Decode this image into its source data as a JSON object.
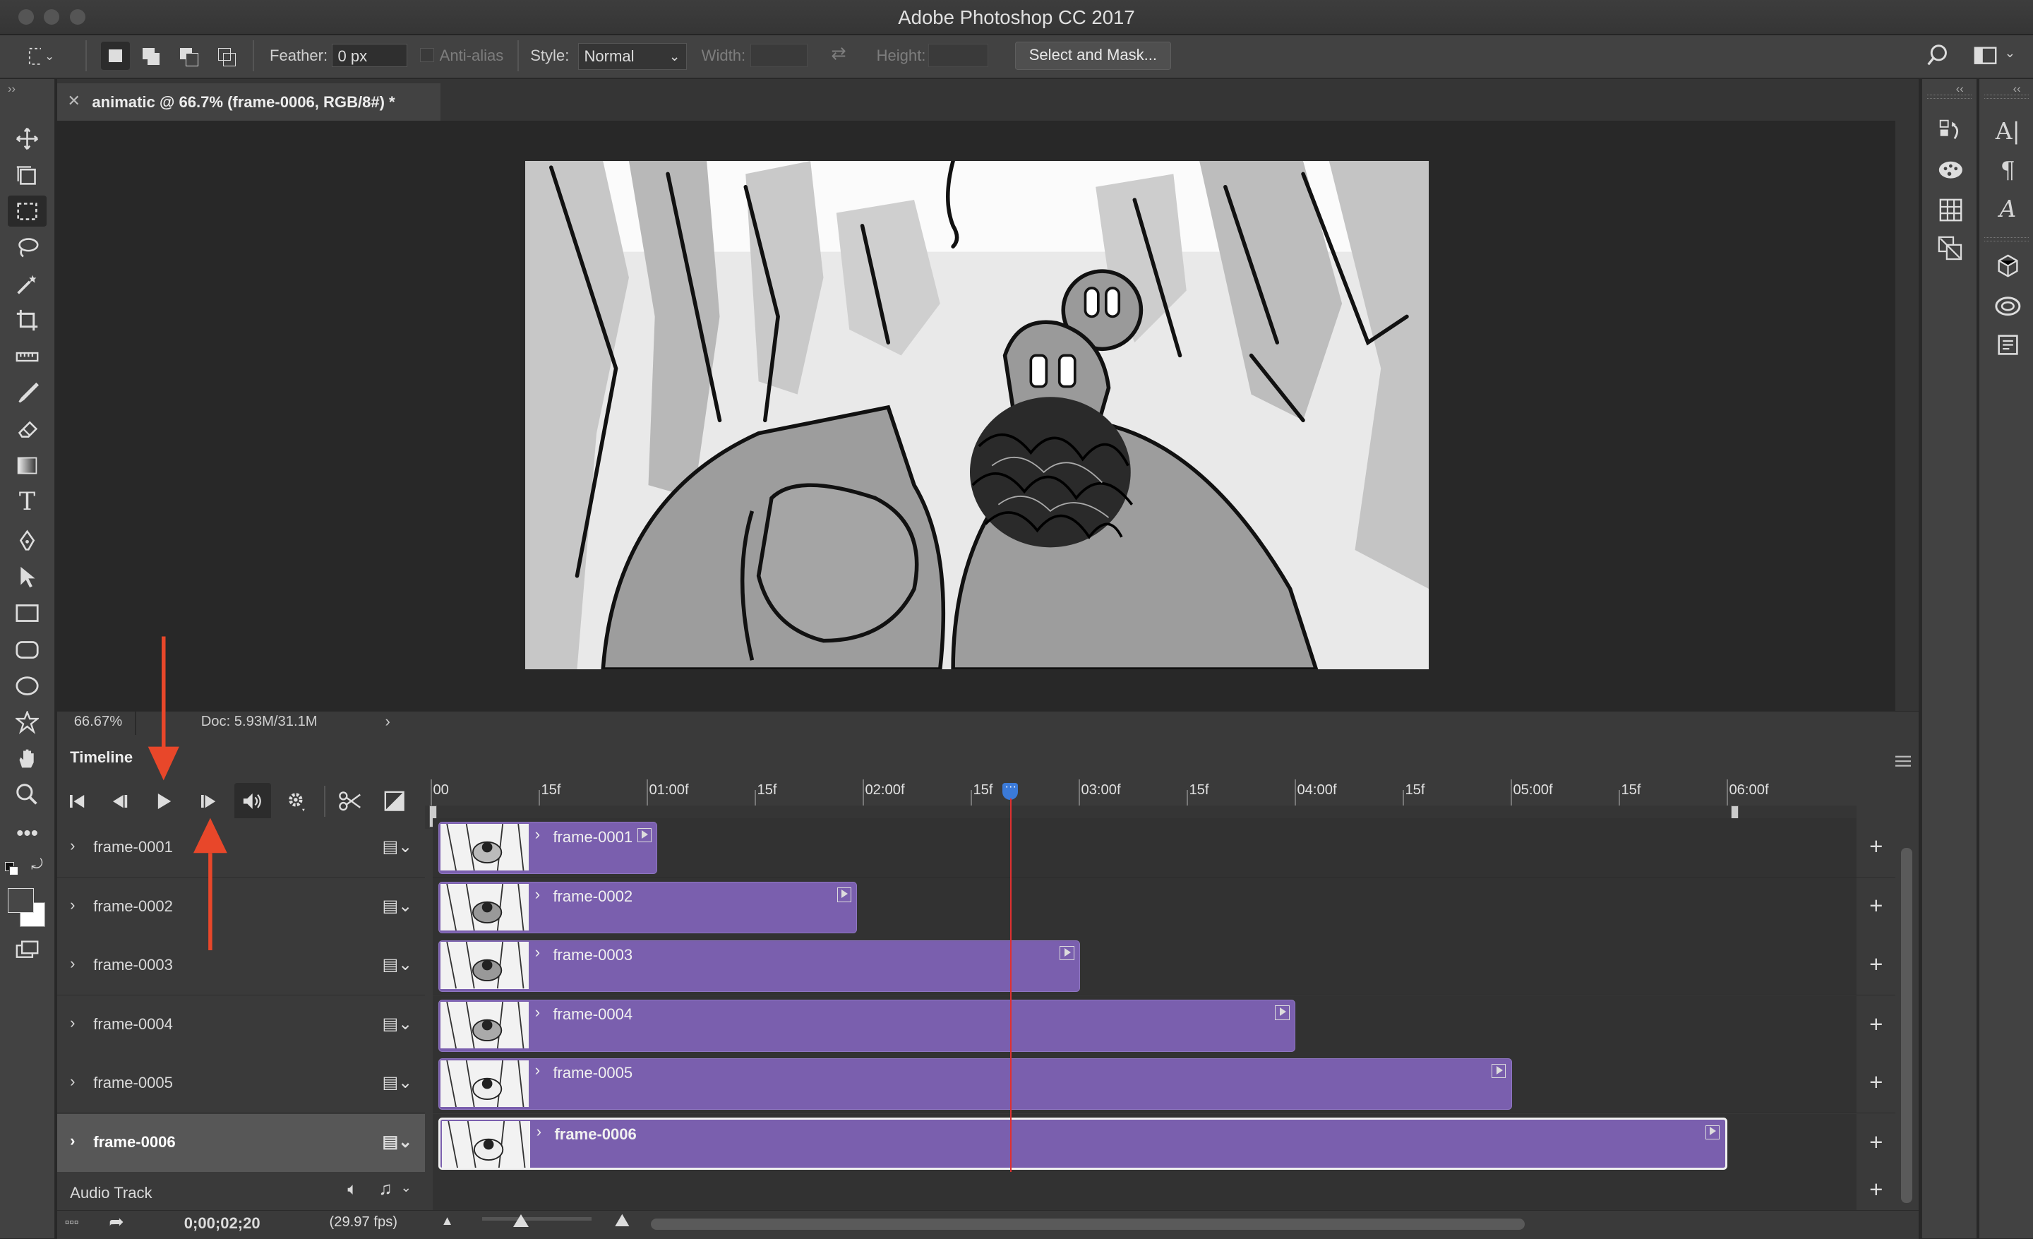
{
  "window": {
    "title": "Adobe Photoshop CC 2017"
  },
  "options_bar": {
    "feather_label": "Feather:",
    "feather_value": "0 px",
    "antialias_label": "Anti-alias",
    "style_label": "Style:",
    "style_value": "Normal",
    "width_label": "Width:",
    "height_label": "Height:",
    "select_mask_label": "Select and Mask..."
  },
  "document": {
    "tab_title": "animatic @ 66.7% (frame-0006, RGB/8#) *",
    "zoom": "66.67%",
    "doc_size": "Doc: 5.93M/31.1M"
  },
  "timeline": {
    "title": "Timeline",
    "ruler_labels": [
      "00",
      "15f",
      "01:00f",
      "15f",
      "02:00f",
      "15f",
      "03:00f",
      "15f",
      "04:00f",
      "15f",
      "05:00f",
      "15f",
      "06:00f"
    ],
    "layers": [
      {
        "name": "frame-0001",
        "clip_label": "frame-0001",
        "selected": false
      },
      {
        "name": "frame-0002",
        "clip_label": "frame-0002",
        "selected": false
      },
      {
        "name": "frame-0003",
        "clip_label": "frame-0003",
        "selected": false
      },
      {
        "name": "frame-0004",
        "clip_label": "frame-0004",
        "selected": false
      },
      {
        "name": "frame-0005",
        "clip_label": "frame-0005",
        "selected": false
      },
      {
        "name": "frame-0006",
        "clip_label": "frame-0006",
        "selected": true
      }
    ],
    "audio_track_label": "Audio Track",
    "timecode": "0;00;02;20",
    "fps": "(29.97 fps)"
  },
  "colors": {
    "clip_purple": "#7a5fae",
    "playhead_red": "#e03030",
    "playhead_handle_blue": "#3b7ad8",
    "annotation_arrow": "#e8472a"
  }
}
